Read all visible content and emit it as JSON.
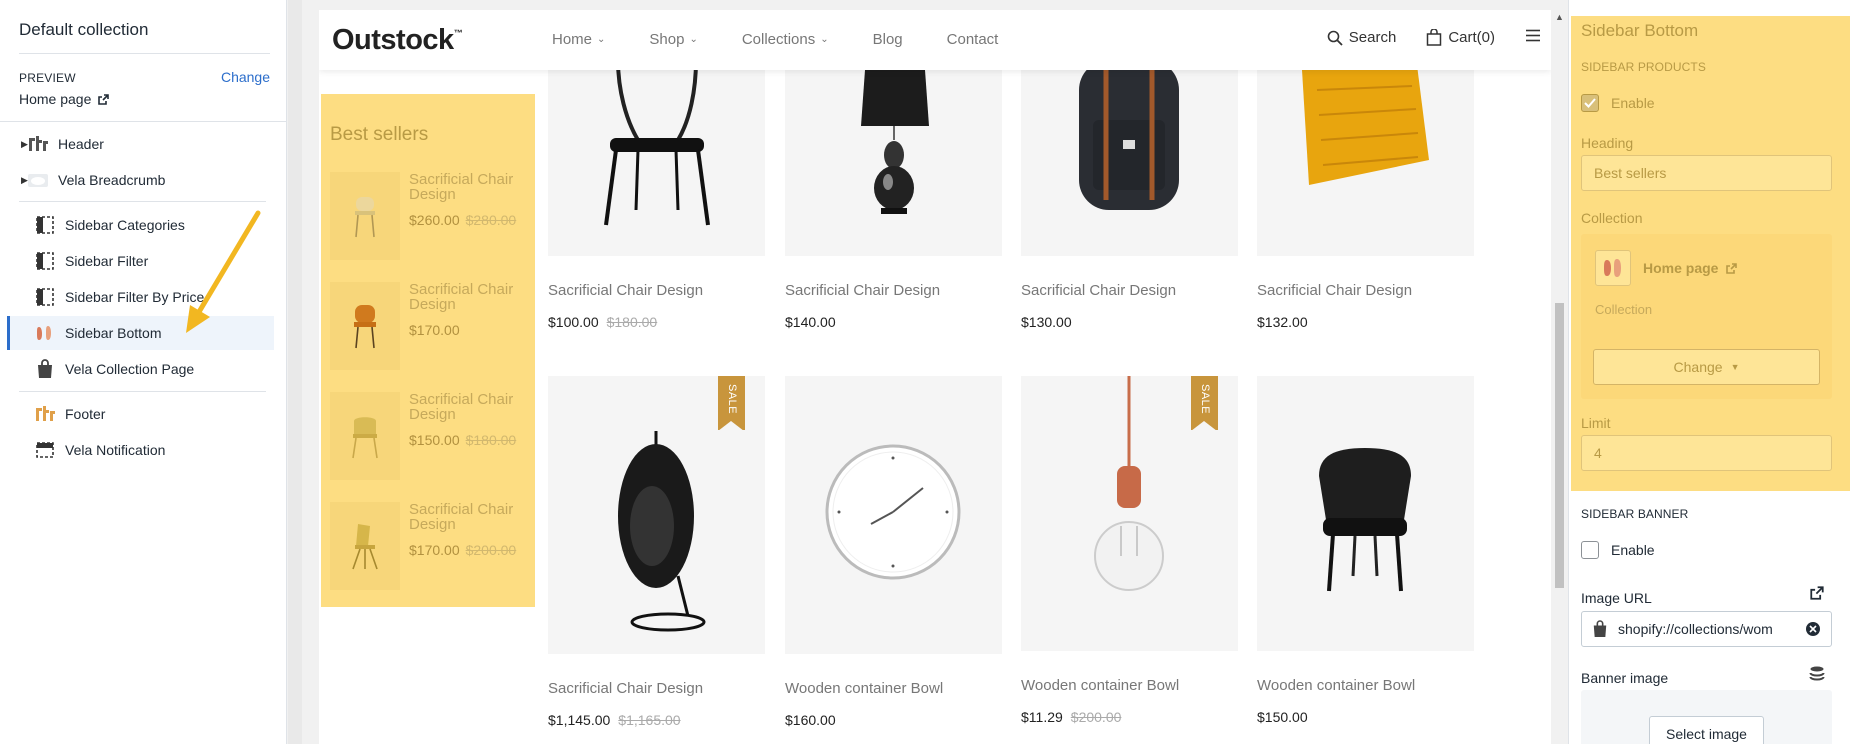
{
  "left": {
    "title": "Default collection",
    "preview_label": "PREVIEW",
    "change_label": "Change",
    "home_label": "Home page",
    "sections": [
      {
        "label": "Header"
      },
      {
        "label": "Vela Breadcrumb"
      },
      {
        "label": "Sidebar Categories"
      },
      {
        "label": "Sidebar Filter"
      },
      {
        "label": "Sidebar Filter By Price"
      },
      {
        "label": "Sidebar Bottom"
      },
      {
        "label": "Vela Collection Page"
      },
      {
        "label": "Footer"
      },
      {
        "label": "Vela Notification"
      }
    ]
  },
  "store": {
    "logo": "Outstock",
    "logo_tm": "™",
    "nav": [
      {
        "label": "Home"
      },
      {
        "label": "Shop"
      },
      {
        "label": "Collections"
      },
      {
        "label": "Blog"
      },
      {
        "label": "Contact"
      }
    ],
    "search_label": "Search",
    "cart_label": "Cart(0)",
    "best_sellers": {
      "heading": "Best sellers",
      "items": [
        {
          "name": "Sacrificial Chair Design",
          "price": "$260.00",
          "old": "$280.00"
        },
        {
          "name": "Sacrificial Chair Design",
          "price": "$170.00",
          "old": ""
        },
        {
          "name": "Sacrificial Chair Design",
          "price": "$150.00",
          "old": "$180.00"
        },
        {
          "name": "Sacrificial Chair Design",
          "price": "$170.00",
          "old": "$200.00"
        }
      ]
    },
    "products": [
      {
        "title": "Sacrificial Chair Design",
        "price": "$100.00",
        "old": "$180.00"
      },
      {
        "title": "Sacrificial Chair Design",
        "price": "$140.00",
        "old": ""
      },
      {
        "title": "Sacrificial Chair Design",
        "price": "$130.00",
        "old": ""
      },
      {
        "title": "Sacrificial Chair Design",
        "price": "$132.00",
        "old": ""
      },
      {
        "title": "Sacrificial Chair Design",
        "price": "$1,145.00",
        "old": "$1,165.00",
        "badge": "SALE"
      },
      {
        "title": "Wooden container Bowl",
        "price": "$160.00",
        "old": ""
      },
      {
        "title": "Wooden container Bowl",
        "price": "$11.29",
        "old": "$200.00",
        "badge": "SALE"
      },
      {
        "title": "Wooden container Bowl",
        "price": "$150.00",
        "old": ""
      }
    ]
  },
  "right": {
    "title": "Sidebar Bottom",
    "products_caption": "SIDEBAR PRODUCTS",
    "enable_label": "Enable",
    "heading_label": "Heading",
    "heading_value": "Best sellers",
    "collection_label": "Collection",
    "collection_name": "Home page",
    "collection_sub": "Collection",
    "change_label": "Change",
    "limit_label": "Limit",
    "limit_value": "4",
    "banner_caption": "SIDEBAR BANNER",
    "banner_enable_label": "Enable",
    "image_url_label": "Image URL",
    "image_url_value": "shopify://collections/wom",
    "banner_image_label": "Banner image",
    "select_image_label": "Select image"
  },
  "colors": {
    "highlight": "#fddd82",
    "accent": "#2c6ecb",
    "sale": "#c8953c"
  }
}
